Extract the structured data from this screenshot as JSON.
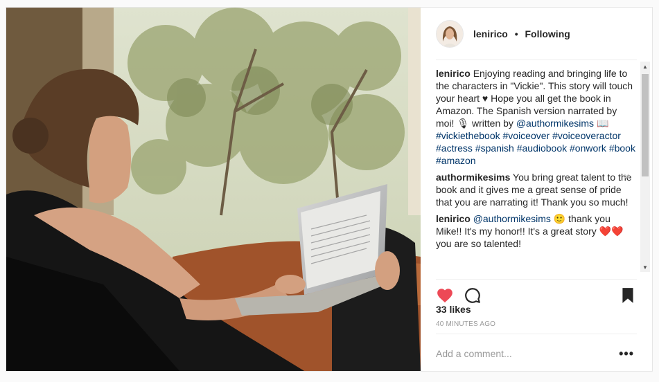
{
  "post": {
    "username": "lenirico",
    "separator": "•",
    "follow_status": "Following"
  },
  "comments": [
    {
      "user": "lenirico",
      "text": "Enjoying reading and bringing life to the characters in \"Vickie\". This story will touch your heart ♥ Hope you all get the book in Amazon. The Spanish version narrated by moi! 🎙 written by",
      "mention": "@authormikesims 📖",
      "hashtags": "#vickiethebook #voiceover #voiceoveractor #actress #spanish #audiobook #onwork #book #amazon"
    },
    {
      "user": "authormikesims",
      "text": "You bring great talent to the book and it gives me a great sense of pride that you are narrating it! Thank you so much!",
      "close": "×"
    },
    {
      "user": "lenirico",
      "mention": "@authormikesims",
      "text": "🙂 thank you Mike!! It's my honor!! It's a great story ❤️❤️ you are so talented!"
    }
  ],
  "stats": {
    "likes": "33 likes",
    "time": "40 MINUTES AGO"
  },
  "comment_box": {
    "placeholder": "Add a comment...",
    "more": "•••"
  },
  "scrollbar": {
    "up": "▲",
    "down": "▼"
  },
  "colors": {
    "heart": "#ed4956",
    "link": "#003569",
    "muted": "#999999"
  },
  "icons": [
    "heart-icon",
    "comment-icon",
    "bookmark-icon",
    "more-options-icon"
  ]
}
